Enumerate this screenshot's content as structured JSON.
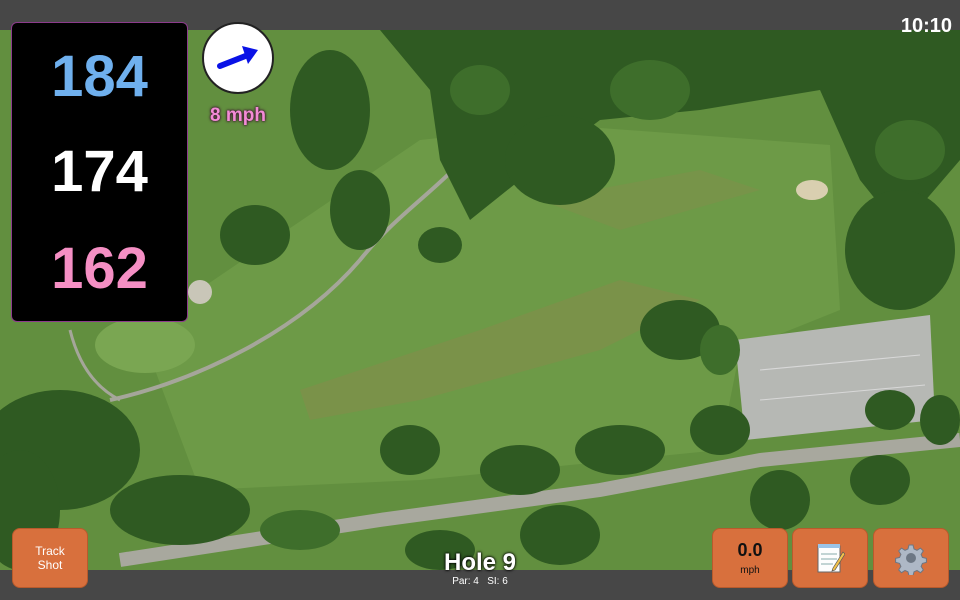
{
  "status": {
    "time": "10:10"
  },
  "distances": {
    "back": "184",
    "middle": "174",
    "front": "162"
  },
  "wind": {
    "speed_label": "8 mph",
    "direction_icon": "wind-arrow-icon",
    "arrow_color": "#0a12e6"
  },
  "buttons": {
    "track_shot_line1": "Track",
    "track_shot_line2": "Shot",
    "speed_value": "0.0",
    "speed_unit": "mph",
    "notes_icon": "notepad-icon",
    "settings_icon": "gear-icon"
  },
  "hole": {
    "title": "Hole 9",
    "par_label": "Par: 4",
    "si_label": "SI: 6"
  },
  "colors": {
    "button_bg": "#d8703d",
    "back_distance": "#6fb0ee",
    "middle_distance": "#ffffff",
    "front_distance": "#f58fc4",
    "wind_text": "#f38bd6"
  }
}
